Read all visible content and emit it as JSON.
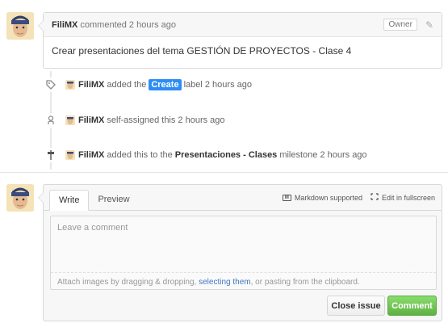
{
  "comment": {
    "author": "FiliMX",
    "meta": "commented 2 hours ago",
    "badge": "Owner",
    "body": "Crear presentaciones del tema GESTIÓN DE PROYECTOS - Clase 4"
  },
  "events": [
    {
      "who": "FiliMX",
      "pre": "added the",
      "label": "Create",
      "post": "label 2 hours ago",
      "icon": "tag-icon"
    },
    {
      "who": "FiliMX",
      "pre": "self-assigned this 2 hours ago",
      "icon": "person-icon"
    },
    {
      "who": "FiliMX",
      "pre": "added this to the",
      "milestone": "Presentaciones - Clases",
      "post": "milestone 2 hours ago",
      "icon": "milestone-icon"
    }
  ],
  "form": {
    "tabs": [
      "Write",
      "Preview"
    ],
    "markdown": "Markdown supported",
    "fullscreen": "Edit in fullscreen",
    "placeholder": "Leave a comment",
    "attach_pre": "Attach images by dragging & dropping,",
    "attach_link": "selecting them",
    "attach_post": ", or pasting from the clipboard.",
    "close_label": "Close issue",
    "comment_label": "Comment"
  },
  "colors": {
    "label": "#2d8df5",
    "comment_button": "#60b044"
  }
}
